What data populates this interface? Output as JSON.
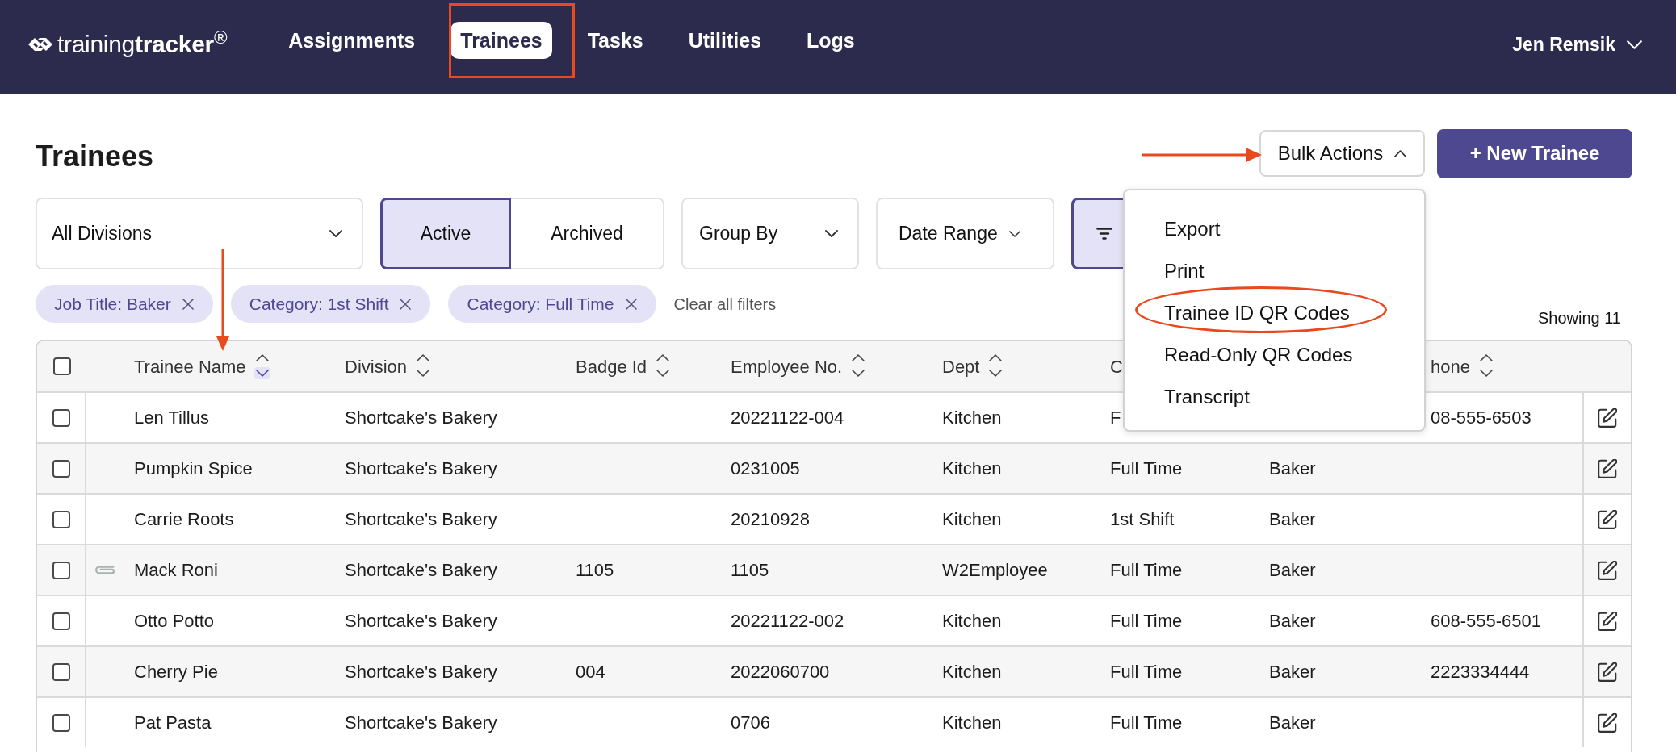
{
  "header": {
    "logo": "training**tracker**$^{®}$",
    "nav": [
      {
        "label": "Assignments",
        "selected": false
      },
      {
        "label": "Trainees",
        "selected": true
      },
      {
        "label": "Tasks",
        "selected": false
      },
      {
        "label": "Utilities",
        "selected": false
      },
      {
        "label": "Logs",
        "selected": false
      }
    ],
    "user": "Jen Remsik"
  },
  "page": {
    "title": "Trainees",
    "bulk_actions": {
      "label": "Bulk Actions",
      "expanded": true,
      "items": [
        "Export",
        "Print",
        "Trainee ID QR Codes",
        "Read-Only QR Codes",
        "Transcript"
      ]
    },
    "new_button": "+ New Trainee"
  },
  "filters": {
    "division": "All Divisions",
    "status": [
      {
        "label": "Active",
        "selected": true
      },
      {
        "label": "Archived",
        "selected": false
      }
    ],
    "group_by": "Group By",
    "date_range": "Date Range",
    "filter_button": {
      "active": true
    },
    "chips": [
      {
        "label": "Job Title: Baker"
      },
      {
        "label": "Category: 1st Shift"
      },
      {
        "label": "Category: Full Time"
      }
    ],
    "clear": "Clear all filters"
  },
  "result_count": "Showing 11",
  "table": {
    "header_checkbox": {
      "checked": false
    },
    "columns": {
      "trainee_name": {
        "label": "Trainee Name",
        "sorted": true
      },
      "division": {
        "label": "Division",
        "sorted": false
      },
      "badge_id": {
        "label": "Badge Id",
        "sorted": false
      },
      "employee_no": {
        "label": "Employee No.",
        "sorted": false
      },
      "dept": {
        "label": "Dept",
        "sorted": false
      },
      "column_6": {
        "label": "C"
      },
      "phone": {
        "label": "hone",
        "sorted": false
      }
    },
    "rows": [
      {
        "checked": false,
        "attachment": false,
        "trainee_name": "Len Tillus",
        "division": "Shortcake's Bakery",
        "employee_no": "20221122-004",
        "dept": "Kitchen",
        "column_6": "F",
        "phone": "08-555-6503"
      },
      {
        "checked": false,
        "attachment": false,
        "trainee_name": "Pumpkin Spice",
        "division": "Shortcake's Bakery",
        "employee_no": "0231005",
        "dept": "Kitchen",
        "column_6": "Full Time",
        "column_7": "Baker"
      },
      {
        "checked": false,
        "attachment": false,
        "trainee_name": "Carrie Roots",
        "division": "Shortcake's Bakery",
        "employee_no": "20210928",
        "dept": "Kitchen",
        "column_6": "1st Shift",
        "column_7": "Baker"
      },
      {
        "checked": false,
        "attachment": true,
        "trainee_name": "Mack Roni",
        "division": "Shortcake's Bakery",
        "badge_id": "1105",
        "employee_no": "1105",
        "dept": "W2Employee",
        "column_6": "Full Time",
        "column_7": "Baker"
      },
      {
        "checked": false,
        "attachment": false,
        "trainee_name": "Otto Potto",
        "division": "Shortcake's Bakery",
        "employee_no": "20221122-002",
        "dept": "Kitchen",
        "column_6": "Full Time",
        "column_7": "Baker",
        "phone": "608-555-6501"
      },
      {
        "checked": false,
        "attachment": false,
        "trainee_name": "Cherry Pie",
        "division": "Shortcake's Bakery",
        "badge_id": "004",
        "employee_no": "2022060700",
        "dept": "Kitchen",
        "column_6": "Full Time",
        "column_7": "Baker",
        "phone": "2223334444"
      },
      {
        "checked": false,
        "attachment": false,
        "trainee_name": "Pat Pasta",
        "division": "Shortcake's Bakery",
        "employee_no": "0706",
        "dept": "Kitchen",
        "column_6": "Full Time",
        "column_7": "Baker"
      }
    ]
  }
}
